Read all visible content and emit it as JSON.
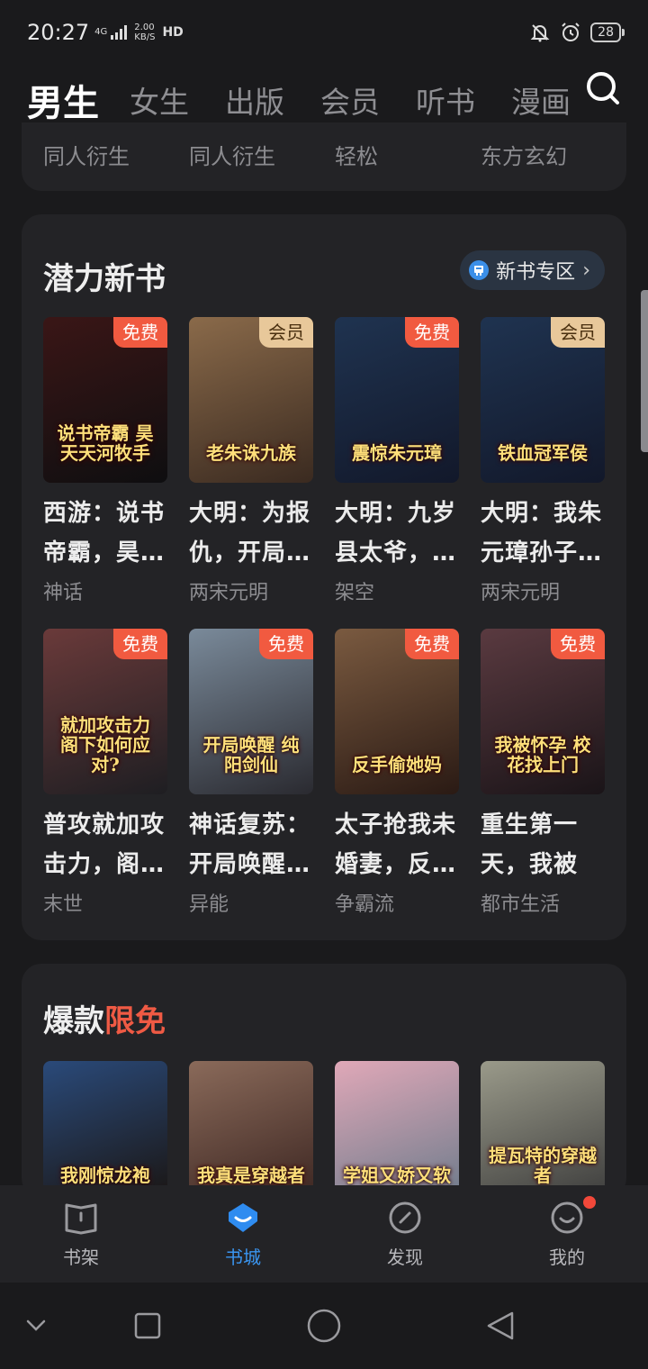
{
  "status_bar": {
    "time": "20:27",
    "network": "4G",
    "speed_value": "2.00",
    "speed_unit": "KB/S",
    "hd": "HD",
    "battery": "28"
  },
  "tabs": [
    {
      "label": "男生",
      "active": true
    },
    {
      "label": "女生"
    },
    {
      "label": "出版"
    },
    {
      "label": "会员"
    },
    {
      "label": "听书"
    },
    {
      "label": "漫画"
    }
  ],
  "top_categories": [
    "同人衍生",
    "同人衍生",
    "轻松",
    "东方玄幻"
  ],
  "potential": {
    "title": "潜力新书",
    "zone_label": "新书专区",
    "books": [
      {
        "cover_text": "说书帝霸 昊天天河牧手",
        "tag": "免费",
        "tag_type": "free",
        "title": "西游：说书帝霸，昊…",
        "genre": "神话",
        "bg": "#3a1616",
        "bg2": "#0e0e10"
      },
      {
        "cover_text": "老朱诛九族",
        "tag": "会员",
        "tag_type": "vip",
        "title": "大明：为报仇，开局…",
        "genre": "两宋元明",
        "bg": "#8a6a4a",
        "bg2": "#3a2a20"
      },
      {
        "cover_text": "震惊朱元璋",
        "tag": "免费",
        "tag_type": "free",
        "title": "大明：九岁县太爷，…",
        "genre": "架空",
        "bg": "#1f3350",
        "bg2": "#12182a"
      },
      {
        "cover_text": "铁血冠军侯",
        "tag": "会员",
        "tag_type": "vip",
        "title": "大明：我朱元璋孙子…",
        "genre": "两宋元明",
        "bg": "#1f3350",
        "bg2": "#12182a"
      },
      {
        "cover_text": "就加攻击力 阁下如何应对?",
        "tag": "免费",
        "tag_type": "free",
        "title": "普攻就加攻击力，阁…",
        "genre": "末世",
        "bg": "#6a3a3a",
        "bg2": "#1e1e22"
      },
      {
        "cover_text": "开局唤醒 纯阳剑仙",
        "tag": "免费",
        "tag_type": "free",
        "title": "神话复苏：开局唤醒…",
        "genre": "异能",
        "bg": "#7a8a9a",
        "bg2": "#2a2a30"
      },
      {
        "cover_text": "反手偷她妈",
        "tag": "免费",
        "tag_type": "free",
        "title": "太子抢我未婚妻，反…",
        "genre": "争霸流",
        "bg": "#7a5a40",
        "bg2": "#2a1a14"
      },
      {
        "cover_text": "我被怀孕 校花找上门",
        "tag": "免费",
        "tag_type": "free",
        "title": "重生第一天，我被怀…",
        "genre": "都市生活",
        "bg": "#5a3a40",
        "bg2": "#1a1418"
      }
    ]
  },
  "hot": {
    "title_main": "爆款",
    "title_accent": "限免",
    "books": [
      {
        "cover_text": "我刚惊龙袍",
        "bg": "#2a4a7a",
        "bg2": "#1a1410"
      },
      {
        "cover_text": "我真是穿越者",
        "bg": "#8a6a5a",
        "bg2": "#3a2420"
      },
      {
        "cover_text": "学姐又娇又软",
        "bg": "#e0a8b8",
        "bg2": "#6a7a8a"
      },
      {
        "cover_text": "提瓦特的穿越者",
        "bg": "#9a9a8a",
        "bg2": "#3a3a3a"
      }
    ]
  },
  "bottom_nav": [
    {
      "label": "书架",
      "icon": "bookshelf-icon"
    },
    {
      "label": "书城",
      "icon": "bookstore-icon",
      "active": true
    },
    {
      "label": "发现",
      "icon": "discover-icon"
    },
    {
      "label": "我的",
      "icon": "profile-icon",
      "badge": true
    }
  ],
  "colors": {
    "accent": "#3a96f2",
    "free_tag": "#f15a40",
    "vip_tag": "#e8c89a",
    "highlight_red": "#ef5a44"
  }
}
